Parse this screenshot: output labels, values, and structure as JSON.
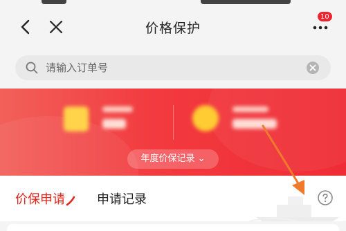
{
  "nav": {
    "title": "价格保护",
    "badge_count": "10",
    "back_icon": "chevron-left-icon",
    "close_icon": "close-icon",
    "more_icon": "more-dots-icon"
  },
  "search": {
    "placeholder": "请输入订单号",
    "value": ""
  },
  "banner": {
    "record_button_label": "年度价保记录",
    "chevron": "⌄",
    "colors": {
      "start": "#f2605a",
      "end": "#ef2c35"
    }
  },
  "tabs": {
    "items": [
      {
        "label": "价保申请",
        "active": true
      },
      {
        "label": "申请记录",
        "active": false
      }
    ],
    "help_icon": "question-circle-icon"
  },
  "accent_color": "#e1251b",
  "annotation_color": "#f07a2c"
}
